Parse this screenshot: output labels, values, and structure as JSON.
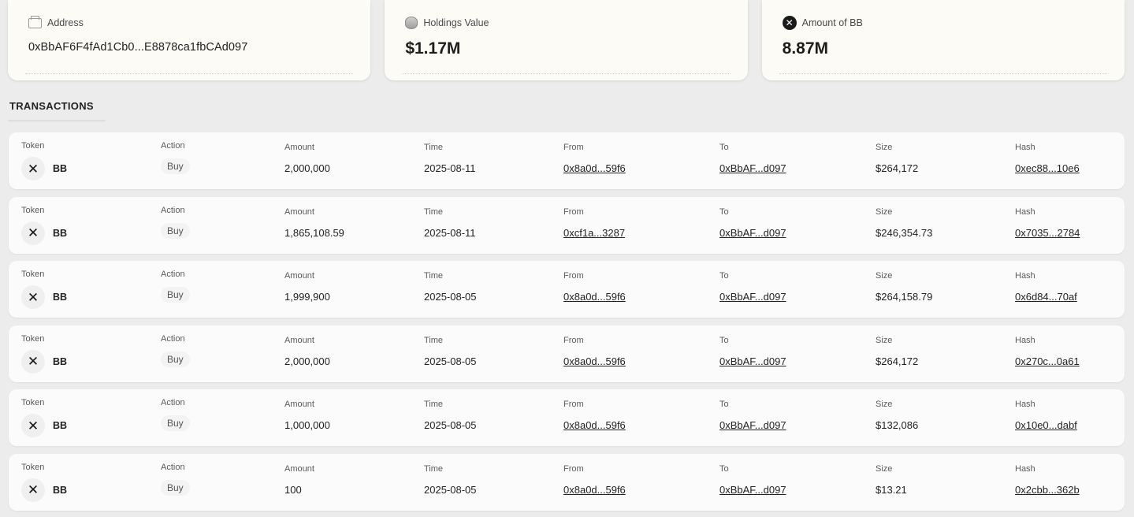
{
  "summary": {
    "address": {
      "label": "Address",
      "value": "0xBbAF6F4fAd1Cb0...E8878ca1fbCAd097",
      "icon": "wallet-icon"
    },
    "holdings": {
      "label": "Holdings Value",
      "value": "$1.17M",
      "icon": "coins-icon"
    },
    "amount": {
      "label": "Amount of BB",
      "value": "8.87M",
      "icon": "bb-token-icon"
    }
  },
  "transactions": {
    "title": "TRANSACTIONS",
    "headers": {
      "token": "Token",
      "action": "Action",
      "amount": "Amount",
      "time": "Time",
      "from": "From",
      "to": "To",
      "size": "Size",
      "hash": "Hash"
    },
    "rows": [
      {
        "token": "BB",
        "action": "Buy",
        "amount": "2,000,000",
        "time": "2025-08-11",
        "from": "0x8a0d...59f6",
        "to": "0xBbAF...d097",
        "size": "$264,172",
        "hash": "0xec88...10e6"
      },
      {
        "token": "BB",
        "action": "Buy",
        "amount": "1,865,108.59",
        "time": "2025-08-11",
        "from": "0xcf1a...3287",
        "to": "0xBbAF...d097",
        "size": "$246,354.73",
        "hash": "0x7035...2784"
      },
      {
        "token": "BB",
        "action": "Buy",
        "amount": "1,999,900",
        "time": "2025-08-05",
        "from": "0x8a0d...59f6",
        "to": "0xBbAF...d097",
        "size": "$264,158.79",
        "hash": "0x6d84...70af"
      },
      {
        "token": "BB",
        "action": "Buy",
        "amount": "2,000,000",
        "time": "2025-08-05",
        "from": "0x8a0d...59f6",
        "to": "0xBbAF...d097",
        "size": "$264,172",
        "hash": "0x270c...0a61"
      },
      {
        "token": "BB",
        "action": "Buy",
        "amount": "1,000,000",
        "time": "2025-08-05",
        "from": "0x8a0d...59f6",
        "to": "0xBbAF...d097",
        "size": "$132,086",
        "hash": "0x10e0...dabf"
      },
      {
        "token": "BB",
        "action": "Buy",
        "amount": "100",
        "time": "2025-08-05",
        "from": "0x8a0d...59f6",
        "to": "0xBbAF...d097",
        "size": "$13.21",
        "hash": "0x2cbb...362b"
      }
    ]
  }
}
